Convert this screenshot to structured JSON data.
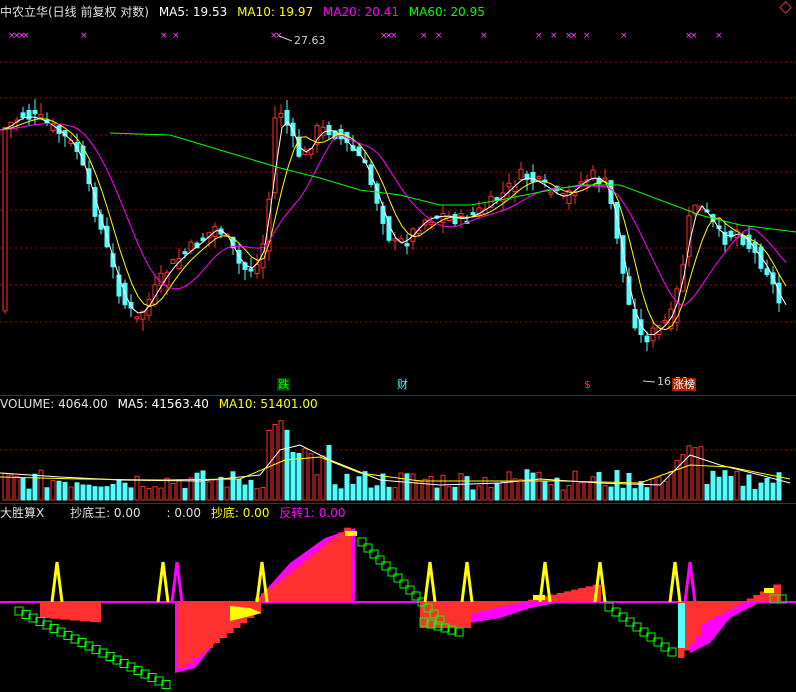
{
  "stock": {
    "title": "中农立华(日线 前复权 对数)",
    "ma5": "MA5: 19.53",
    "ma10": "MA10: 19.97",
    "ma20": "MA20: 20.41",
    "ma60": "MA60: 20.95"
  },
  "price_labels": {
    "high": "27.63",
    "low": "16.39"
  },
  "event_markers": [
    "跌",
    "财",
    "$",
    "涨榜"
  ],
  "volume": {
    "label": "VOLUME: 4064.00",
    "ma5": "MA5: 41563.40",
    "ma10": "MA10: 51401.00"
  },
  "indicator": {
    "name": "大胜算X",
    "d1": "抄底王: 0.00",
    "d2": ": 0.00",
    "d3": "抄底: 0.00",
    "d4": "反转1: 0.00"
  },
  "colors": {
    "up": "#ff3030",
    "down": "#54fcfc",
    "ma5": "#ffffff",
    "ma10": "#ffff00",
    "ma20": "#ff00ff",
    "ma60": "#00ff00",
    "grid": "#b00000"
  },
  "icons": [
    "diamond-icon"
  ]
}
